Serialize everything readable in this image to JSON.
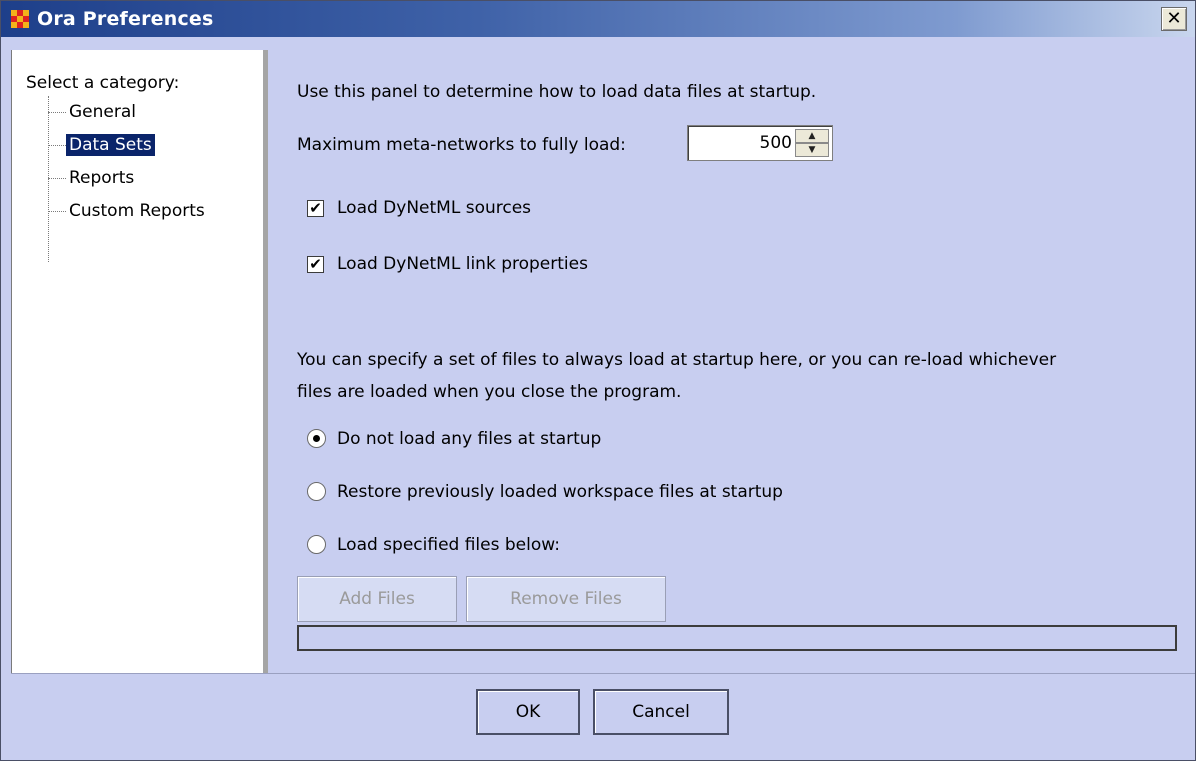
{
  "window": {
    "title": "Ora Preferences",
    "close_glyph": "✕",
    "icon": "ora-app-icon"
  },
  "tree": {
    "header": "Select a category:",
    "items": [
      {
        "label": "General",
        "selected": false
      },
      {
        "label": "Data Sets",
        "selected": true
      },
      {
        "label": "Reports",
        "selected": false
      },
      {
        "label": "Custom Reports",
        "selected": false
      }
    ]
  },
  "panel": {
    "intro": "Use this panel to determine how to load data files at startup.",
    "max_meta_label": "Maximum meta-networks to fully load:",
    "max_meta_value": "500",
    "checkboxes": [
      {
        "label": "Load DyNetML sources",
        "checked": true
      },
      {
        "label": "Load DyNetML link properties",
        "checked": true
      }
    ],
    "startup_desc_line1": "You can specify a set of files to always load at startup here, or you can re-load whichever",
    "startup_desc_line2": "files are loaded when you close the program.",
    "radios": [
      {
        "label": "Do not load any files at startup",
        "selected": true
      },
      {
        "label": "Restore previously loaded workspace files at startup",
        "selected": false
      },
      {
        "label": "Load specified files below:",
        "selected": false
      }
    ],
    "add_files_label": "Add Files",
    "remove_files_label": "Remove Files"
  },
  "footer": {
    "ok_label": "OK",
    "cancel_label": "Cancel"
  },
  "colors": {
    "background": "#c8cef0",
    "titlebar_start": "#1e3f8a",
    "selection": "#0a246a"
  }
}
